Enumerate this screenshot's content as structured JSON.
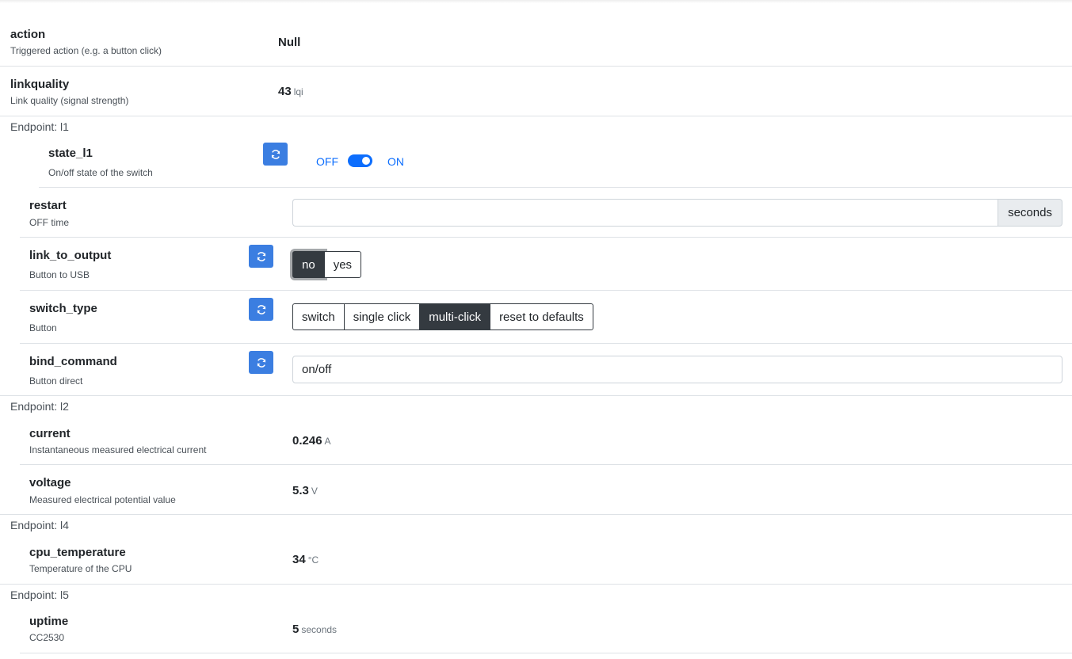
{
  "rows": {
    "action": {
      "name": "action",
      "desc": "Triggered action (e.g. a button click)",
      "value": "Null"
    },
    "linkquality": {
      "name": "linkquality",
      "desc": "Link quality (signal strength)",
      "value": "43",
      "unit": "lqi"
    },
    "state_l1": {
      "name": "state_l1",
      "desc": "On/off state of the switch",
      "off_label": "OFF",
      "on_label": "ON",
      "state": "ON"
    },
    "restart": {
      "name": "restart",
      "desc": "OFF time",
      "value": "",
      "unit": "seconds"
    },
    "link_to_output": {
      "name": "link_to_output",
      "desc": "Button to USB",
      "options": [
        "no",
        "yes"
      ],
      "selected": "no"
    },
    "switch_type": {
      "name": "switch_type",
      "desc": "Button",
      "options": [
        "switch",
        "single click",
        "multi-click",
        "reset to defaults"
      ],
      "selected": "multi-click"
    },
    "bind_command": {
      "name": "bind_command",
      "desc": "Button direct",
      "value": "on/off"
    },
    "current": {
      "name": "current",
      "desc": "Instantaneous measured electrical current",
      "value": "0.246",
      "unit": "A"
    },
    "voltage": {
      "name": "voltage",
      "desc": "Measured electrical potential value",
      "value": "5.3",
      "unit": "V"
    },
    "cpu_temperature": {
      "name": "cpu_temperature",
      "desc": "Temperature of the CPU",
      "value": "34",
      "unit": "°C"
    },
    "uptime": {
      "name": "uptime",
      "desc": "CC2530",
      "value": "5",
      "unit": "seconds"
    }
  },
  "endpoints": {
    "l1": "Endpoint: l1",
    "l2": "Endpoint: l2",
    "l4": "Endpoint: l4",
    "l5": "Endpoint: l5"
  },
  "icons": {
    "refresh": "refresh-icon"
  },
  "colors": {
    "accent": "#3b7ee1",
    "toggle": "#0d6efd",
    "active_button": "#343a40"
  }
}
